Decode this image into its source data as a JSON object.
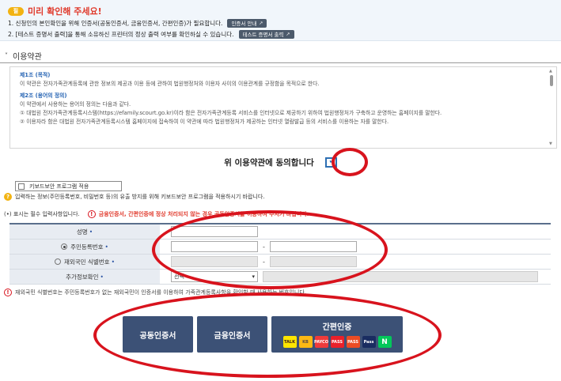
{
  "notice": {
    "badge": "필",
    "title": "미리 확인해 주세요!",
    "line1": "1. 신청인의 본인확인을 위해 인증서(공동인증서, 금융인증서, 간편인증)가 필요합니다.",
    "line1_button": "인증서 안내",
    "line2": "2. [테스트 증명서 출력]을 통해 소유하신 프린터의 정상 출력 여부를 확인하실 수 있습니다.",
    "line2_button": "테스트 증명서 출력"
  },
  "terms": {
    "section_title": "이용약관",
    "lines": [
      "제1조 (목적)",
      "이 약관은 전자가족관계등록에 관한 정보의 제공과 이용 등에 관하여 법원행정처와 이용자 사이의 이용관계를 규정함을 목적으로 한다.",
      "제2조 (용어의 정의)",
      "이 약관에서 사용하는 용어의 정의는 다음과 같다.",
      "① 대법원 전자가족관계등록시스템(https://efamily.scourt.go.kr)이라 함은 전자가족관계등록 서비스를 인터넷으로 제공하기 위하여 법원행정처가 구축하고 운영하는 홈페이지를 말한다.",
      "② 이용자라 함은 대법원 전자가족관계등록시스템 홈페이지에 접속하여 이 약관에 따라 법원행정처가 제공하는 인터넷 열람발급 등의 서비스를 이용하는 자를 말한다."
    ],
    "agree_label": "위 이용약관에 동의합니다",
    "agree_checked": true
  },
  "keyboard": {
    "button_label": "키보드보안 프로그램 적용",
    "note": "입력하는 정보(주민등록번호, 비밀번호 등)의 유출 방지를 위해 키보드보안 프로그램을 적용하시기 바랍니다."
  },
  "required_note": "(•) 표시는 필수 입력사항입니다.",
  "warning": "금융인증서, 간편인증에 정상 처리되지 않는 경우 공동인증서를 이용하여 주시기 바랍니다.",
  "form": {
    "name_label": "성명",
    "rrn_label": "주민등록번호",
    "foreign_label": "재외국민 식별번호",
    "extra_label": "추가정보확인",
    "extra_select": "선택",
    "dash": "-",
    "required_mark": "•"
  },
  "foreign_note": "재외국민 식별번호는 주민등록번호가 없는 재외국민이 인증서를 이용하여 가족관계등록사항을 확인할 때 사용하는 번호입니다.",
  "auth": {
    "joint_cert": "공동인증서",
    "finance_cert": "금융인증서",
    "simple_auth": "간편인증",
    "providers": [
      {
        "name": "kakao",
        "text": "TALK"
      },
      {
        "name": "kb",
        "text": "KB"
      },
      {
        "name": "payco",
        "text": "PAYCO"
      },
      {
        "name": "pass",
        "text": "PASS"
      },
      {
        "name": "pass2",
        "text": "PASS"
      },
      {
        "name": "pass3",
        "text": "Pass"
      },
      {
        "name": "naver",
        "text": "N"
      }
    ]
  },
  "colors": {
    "accent_red": "#d8131d",
    "nav_blue": "#3c5176",
    "title_red": "#e0392b"
  }
}
